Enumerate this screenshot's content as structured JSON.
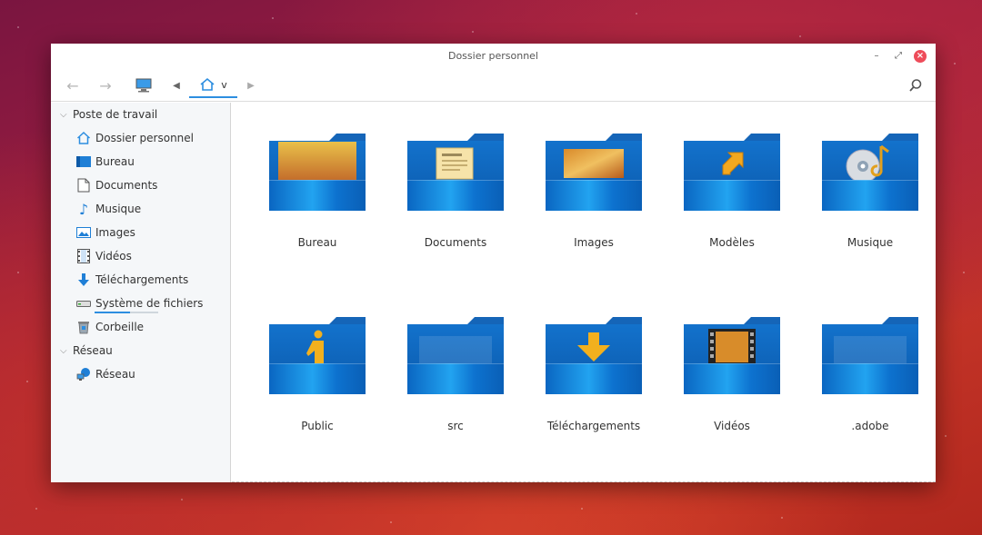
{
  "window": {
    "title": "Dossier personnel"
  },
  "toolbar": {
    "breadcrumb_current": "v"
  },
  "sidebar": {
    "sections": [
      {
        "title": "Poste de travail"
      },
      {
        "title": "Réseau"
      }
    ],
    "items": [
      {
        "label": "Dossier personnel",
        "icon": "home-icon"
      },
      {
        "label": "Bureau",
        "icon": "desktop-icon"
      },
      {
        "label": "Documents",
        "icon": "document-icon"
      },
      {
        "label": "Musique",
        "icon": "music-note-icon"
      },
      {
        "label": "Images",
        "icon": "image-icon"
      },
      {
        "label": "Vidéos",
        "icon": "film-icon"
      },
      {
        "label": "Téléchargements",
        "icon": "download-arrow-icon"
      },
      {
        "label": "Système de fichiers",
        "icon": "drive-icon",
        "usage": 0.55
      },
      {
        "label": "Corbeille",
        "icon": "trash-icon"
      },
      {
        "label": "Réseau",
        "icon": "network-icon"
      }
    ]
  },
  "folders": [
    {
      "label": "Bureau",
      "emblem": "desktop-emblem"
    },
    {
      "label": "Documents",
      "emblem": "document-emblem"
    },
    {
      "label": "Images",
      "emblem": "image-emblem"
    },
    {
      "label": "Modèles",
      "emblem": "arrow-emblem"
    },
    {
      "label": "Musique",
      "emblem": "music-cd-emblem"
    },
    {
      "label": "Public",
      "emblem": "person-emblem"
    },
    {
      "label": "src",
      "emblem": "blank-emblem"
    },
    {
      "label": "Téléchargements",
      "emblem": "download-emblem"
    },
    {
      "label": "Vidéos",
      "emblem": "film-emblem"
    },
    {
      "label": ".adobe",
      "emblem": "blank-emblem"
    }
  ],
  "colors": {
    "accent": "#2d8ee0",
    "folder": "#0e63b8",
    "close": "#ee4c5a"
  }
}
